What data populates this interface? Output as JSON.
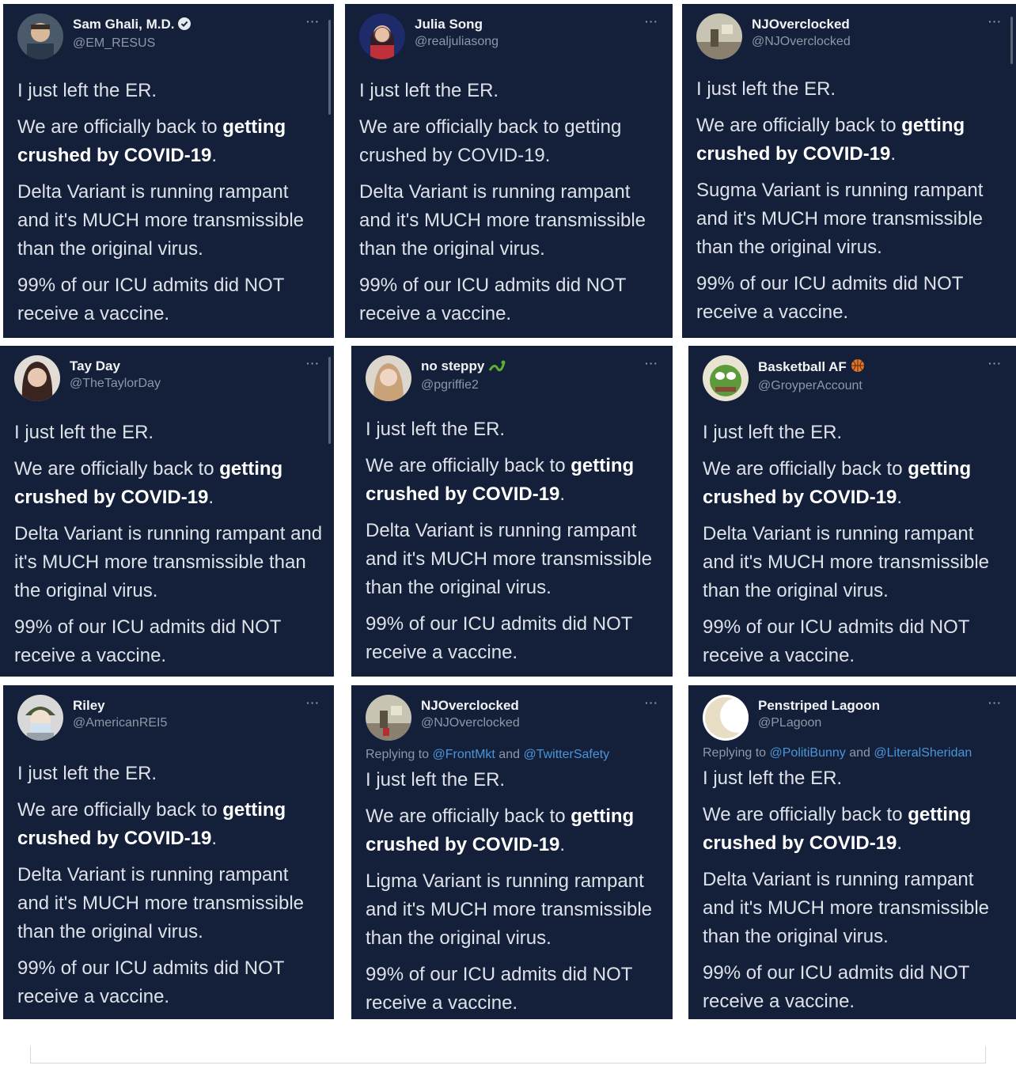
{
  "tweets": [
    {
      "display_name": "Sam Ghali, M.D.",
      "verified": true,
      "handle": "@EM_RESUS",
      "more": "···",
      "reply": null,
      "lines": {
        "l1": "I just left the ER.",
        "l2a": "We are officially back to ",
        "l2b": "getting crushed by COVID-19",
        "l2c": ".",
        "l3": "Delta Variant is running rampant and it's MUCH more transmissible than the original virus.",
        "l4": "99% of our ICU admits did NOT receive a vaccine."
      }
    },
    {
      "display_name": "Julia Song",
      "verified": false,
      "handle": "@realjuliasong",
      "more": "···",
      "reply": null,
      "lines": {
        "l1": "I just left the ER.",
        "l2a": "We are officially back to getting crushed by COVID-19.",
        "l2b": "",
        "l2c": "",
        "l3": "Delta Variant is running rampant and it's MUCH more transmissible than the original virus.",
        "l4": "99% of our ICU admits did NOT receive a vaccine."
      }
    },
    {
      "display_name": "NJOverclocked",
      "verified": false,
      "handle": "@NJOverclocked",
      "more": "···",
      "reply": null,
      "lines": {
        "l1": "I just left the ER.",
        "l2a": "We are officially back to ",
        "l2b": "getting crushed by COVID-19",
        "l2c": ".",
        "l3": "Sugma Variant is running rampant and it's MUCH more transmissible than the original virus.",
        "l4": "99% of our ICU admits did NOT receive a vaccine."
      }
    },
    {
      "display_name": "Tay Day",
      "verified": false,
      "handle": "@TheTaylorDay",
      "more": "···",
      "reply": null,
      "lines": {
        "l1": "I just left the ER.",
        "l2a": "We are officially back to ",
        "l2b": "getting crushed by COVID-19",
        "l2c": ".",
        "l3": "Delta Variant is running rampant and it's MUCH more transmissible than the original virus.",
        "l4": "99% of our ICU admits did NOT receive a vaccine."
      }
    },
    {
      "display_name": "no steppy",
      "verified": false,
      "handle": "@pgriffie2",
      "more": "···",
      "reply": null,
      "lines": {
        "l1": "I just left the ER.",
        "l2a": "We are officially back to ",
        "l2b": "getting crushed by COVID-19",
        "l2c": ".",
        "l3": "Delta Variant is running rampant and it's MUCH more transmissible than the original virus.",
        "l4": "99% of our ICU admits did NOT receive a vaccine."
      }
    },
    {
      "display_name": "Basketball AF",
      "verified": false,
      "handle": "@GroyperAccount",
      "more": "···",
      "reply": null,
      "lines": {
        "l1": "I just left the ER.",
        "l2a": "We are officially back to ",
        "l2b": "getting crushed by COVID-19",
        "l2c": ".",
        "l3": "Delta Variant is running rampant and it's MUCH more transmissible than the original virus.",
        "l4": "99% of our ICU admits did NOT receive a vaccine."
      }
    },
    {
      "display_name": "Riley",
      "verified": false,
      "handle": "@AmericanREI5",
      "more": "···",
      "reply": null,
      "lines": {
        "l1": "I just left the ER.",
        "l2a": "We are officially back to ",
        "l2b": "getting crushed by COVID-19",
        "l2c": ".",
        "l3": "Delta Variant is running rampant and it's MUCH more transmissible than the original virus.",
        "l4": "99% of our ICU admits did NOT receive a vaccine."
      }
    },
    {
      "display_name": "NJOverclocked",
      "verified": false,
      "handle": "@NJOverclocked",
      "more": "···",
      "reply": {
        "prefix": "Replying to ",
        "m1": "@FrontMkt",
        "and": " and ",
        "m2": "@TwitterSafety"
      },
      "lines": {
        "l1": "I just left the ER.",
        "l2a": "We are officially back to ",
        "l2b": "getting crushed by COVID-19",
        "l2c": ".",
        "l3": "Ligma Variant is running rampant and it's MUCH more transmissible than the original virus.",
        "l4": "99% of our ICU admits did NOT receive a vaccine."
      }
    },
    {
      "display_name": "Penstriped Lagoon",
      "verified": false,
      "handle": "@PLagoon",
      "more": "···",
      "reply": {
        "prefix": "Replying to ",
        "m1": "@PolitiBunny",
        "and": " and ",
        "m2": "@LiteralSheridan"
      },
      "lines": {
        "l1": "I just left the ER.",
        "l2a": "We are officially back to ",
        "l2b": "getting crushed by COVID-19",
        "l2c": ".",
        "l3": "Delta Variant is running rampant and it's MUCH more transmissible than the original virus.",
        "l4": "99% of our ICU admits did NOT receive a vaccine."
      }
    }
  ],
  "icons": {
    "verified": "verified-badge-icon",
    "snake_emoji": "snake-icon",
    "basketball_emoji": "basketball-icon",
    "more": "more-options-icon"
  },
  "colors": {
    "card_bg": "#14203a",
    "text": "#dde1e8",
    "muted": "#8d97a8",
    "link": "#4a95d8"
  }
}
